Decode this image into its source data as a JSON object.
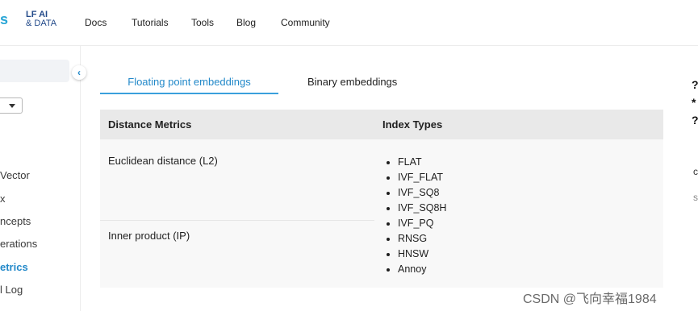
{
  "header": {
    "brand_partial": "s",
    "lf_logo_line1": "LF AI",
    "lf_logo_line2": "& DATA",
    "nav": [
      "Docs",
      "Tutorials",
      "Tools",
      "Blog",
      "Community"
    ]
  },
  "sidebar": {
    "items": [
      "Vector",
      "x",
      "ncepts",
      "erations",
      "etrics",
      "l Log"
    ],
    "active_index": 4
  },
  "tabs": {
    "active": "Floating point embeddings",
    "inactive": "Binary embeddings"
  },
  "table": {
    "headers": [
      "Distance Metrics",
      "Index Types"
    ],
    "metrics": [
      "Euclidean distance (L2)",
      "Inner product (IP)"
    ],
    "index_types": [
      "FLAT",
      "IVF_FLAT",
      "IVF_SQ8",
      "IVF_SQ8H",
      "IVF_PQ",
      "RNSG",
      "HNSW",
      "Annoy"
    ]
  },
  "right_partial": {
    "glyphs": [
      "?",
      "*",
      "?"
    ],
    "text1": "c",
    "text2": "s"
  },
  "watermark": "CSDN @飞向幸福1984"
}
